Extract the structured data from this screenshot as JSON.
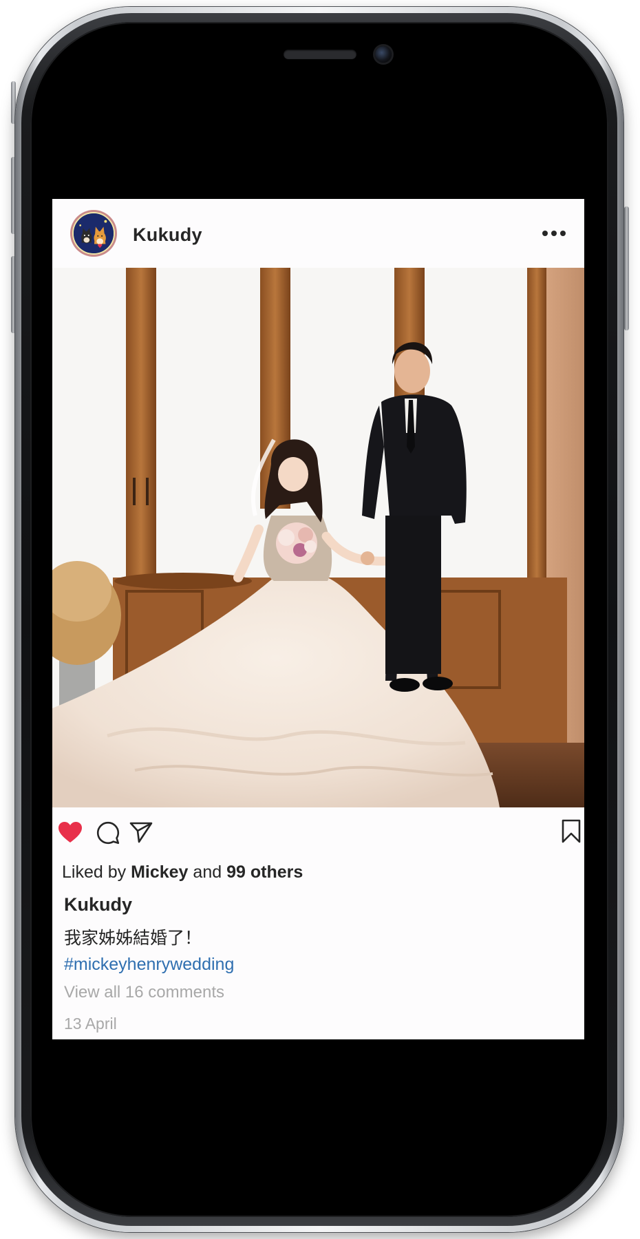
{
  "post": {
    "username": "Kukudy",
    "liked_by_prefix": "Liked by",
    "liked_by_user": "Mickey",
    "liked_by_joiner": "and",
    "liked_by_others": "99 others",
    "caption_user": "Kukudy",
    "caption_text": "我家姊姊結婚了！",
    "hashtag": "#mickeyhenrywedding",
    "view_comments": "View all 16 comments",
    "date": "13 April",
    "liked": true
  },
  "icons": {
    "avatar": "dog-avatar-icon",
    "more": "more-horizontal-icon",
    "like": "heart-filled-icon",
    "comment": "comment-bubble-icon",
    "share": "paper-plane-icon",
    "save": "bookmark-icon"
  },
  "colors": {
    "like_red": "#e8304a",
    "hashtag_blue": "#2f6fb0",
    "muted_gray": "#a8a8a8",
    "text_dark": "#262626",
    "screen_bg": "#fdfcfd"
  }
}
